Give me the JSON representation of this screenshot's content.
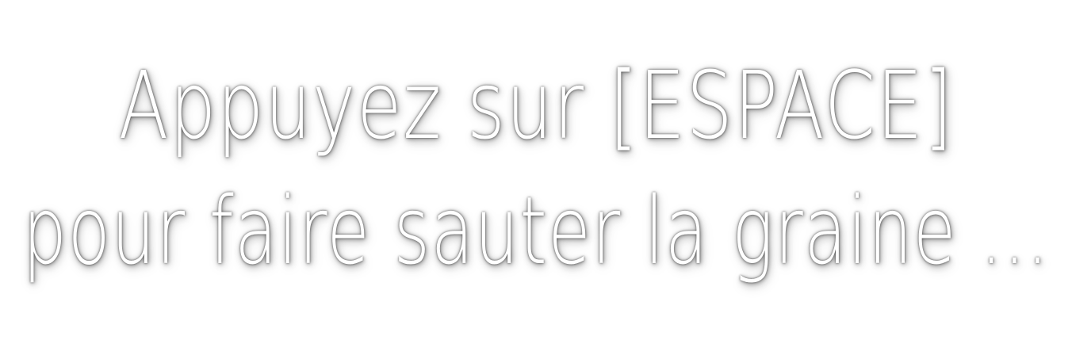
{
  "prompt": {
    "line1": "Appuyez sur [ESPACE]",
    "line2": "pour faire sauter la graine ..."
  },
  "colors": {
    "background": "#ffffff",
    "text": "#ffffff",
    "shadow": "#000000"
  }
}
